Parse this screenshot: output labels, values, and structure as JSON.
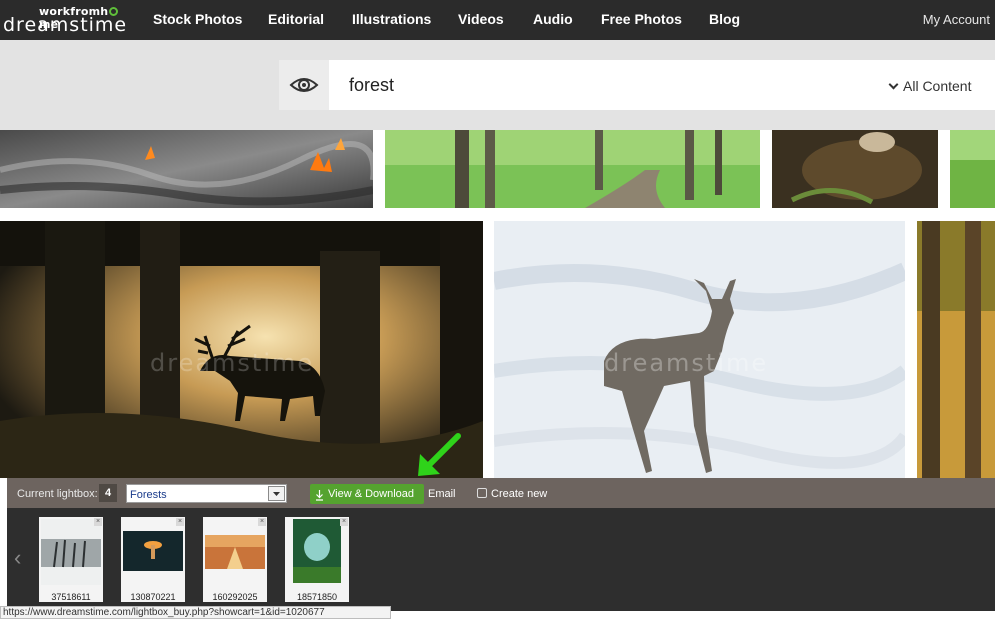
{
  "header": {
    "logo_top": "workfromh",
    "logo_top_end": "me",
    "logo_main": "dreamstime",
    "nav": [
      "Stock Photos",
      "Editorial",
      "Illustrations",
      "Videos",
      "Audio",
      "Free Photos",
      "Blog"
    ],
    "account": "My Account"
  },
  "search": {
    "value": "forest",
    "filter": "All Content"
  },
  "watermark": "dreamstime",
  "lightbox": {
    "label": "Current lightbox:",
    "count": "4",
    "selected": "Forests",
    "view_download": "View & Download",
    "email": "Email",
    "create_new": "Create new",
    "thumbs": [
      "37518611",
      "130870221",
      "160292025",
      "18571850"
    ]
  },
  "status_url": "https://www.dreamstime.com/lightbox_buy.php?showcart=1&id=1020677",
  "colors": {
    "topbar": "#2b2b2b",
    "accent_green": "#55a32f",
    "lightbox_bar": "#6d645f",
    "tray": "#2e2e2e"
  }
}
